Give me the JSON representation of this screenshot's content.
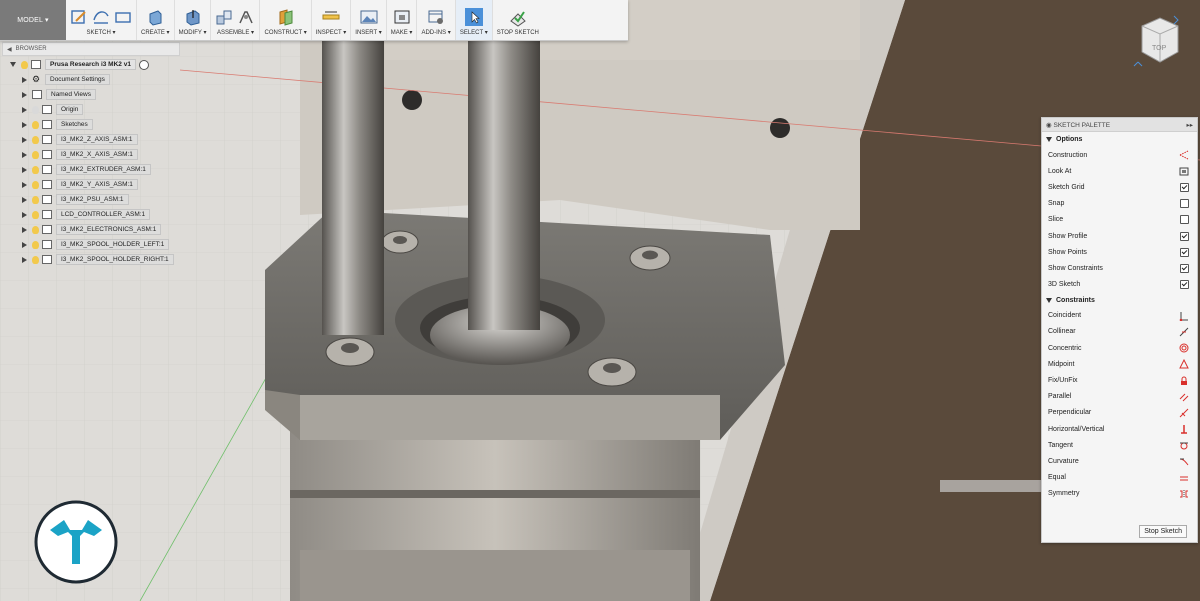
{
  "toolbar": {
    "workspace": "MODEL ▾",
    "groups": [
      {
        "label": "SKETCH ▾"
      },
      {
        "label": "CREATE ▾"
      },
      {
        "label": "MODIFY ▾"
      },
      {
        "label": "ASSEMBLE ▾"
      },
      {
        "label": "CONSTRUCT ▾"
      },
      {
        "label": "INSPECT ▾"
      },
      {
        "label": "INSERT ▾"
      },
      {
        "label": "MAKE ▾"
      },
      {
        "label": "ADD-INS ▾"
      },
      {
        "label": "SELECT ▾"
      },
      {
        "label": "STOP SKETCH"
      }
    ]
  },
  "browser": {
    "title": "BROWSER",
    "root": "Prusa Research i3 MK2 v1",
    "items": [
      {
        "label": "Document Settings"
      },
      {
        "label": "Named Views"
      },
      {
        "label": "Origin"
      },
      {
        "label": "Sketches"
      },
      {
        "label": "I3_MK2_Z_AXIS_ASM:1"
      },
      {
        "label": "I3_MK2_X_AXIS_ASM:1"
      },
      {
        "label": "I3_MK2_EXTRUDER_ASM:1"
      },
      {
        "label": "I3_MK2_Y_AXIS_ASM:1"
      },
      {
        "label": "I3_MK2_PSU_ASM:1"
      },
      {
        "label": "LCD_CONTROLLER_ASM:1"
      },
      {
        "label": "I3_MK2_ELECTRONICS_ASM:1"
      },
      {
        "label": "I3_MK2_SPOOL_HOLDER_LEFT:1"
      },
      {
        "label": "I3_MK2_SPOOL_HOLDER_RIGHT:1"
      }
    ]
  },
  "palette": {
    "title": "SKETCH PALETTE",
    "options_header": "Options",
    "options": [
      {
        "label": "Construction",
        "icon": "construction-icon"
      },
      {
        "label": "Look At",
        "icon": "look-at-icon"
      },
      {
        "label": "Sketch Grid",
        "checked": true
      },
      {
        "label": "Snap",
        "checked": false
      },
      {
        "label": "Slice",
        "checked": false
      },
      {
        "label": "Show Profile",
        "checked": true
      },
      {
        "label": "Show Points",
        "checked": true
      },
      {
        "label": "Show Constraints",
        "checked": true
      },
      {
        "label": "3D Sketch",
        "checked": true
      }
    ],
    "constraints_header": "Constraints",
    "constraints": [
      {
        "label": "Coincident",
        "icon": "coincident-icon"
      },
      {
        "label": "Collinear",
        "icon": "collinear-icon"
      },
      {
        "label": "Concentric",
        "icon": "concentric-icon"
      },
      {
        "label": "Midpoint",
        "icon": "midpoint-icon"
      },
      {
        "label": "Fix/UnFix",
        "icon": "lock-icon"
      },
      {
        "label": "Parallel",
        "icon": "parallel-icon"
      },
      {
        "label": "Perpendicular",
        "icon": "perpendicular-icon"
      },
      {
        "label": "Horizontal/Vertical",
        "icon": "horizontal-vertical-icon"
      },
      {
        "label": "Tangent",
        "icon": "tangent-icon"
      },
      {
        "label": "Curvature",
        "icon": "curvature-icon"
      },
      {
        "label": "Equal",
        "icon": "equal-icon"
      },
      {
        "label": "Symmetry",
        "icon": "symmetry-icon"
      }
    ],
    "stop_label": "Stop Sketch"
  },
  "viewcube": {
    "face": "TOP"
  },
  "colors": {
    "accent": "#4a90d9",
    "brand_logo": "#1ba3c6",
    "constraint_red": "#d9302c"
  }
}
